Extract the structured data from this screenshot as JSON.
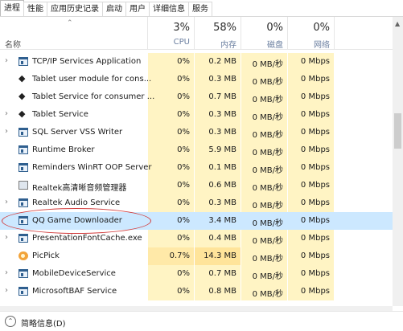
{
  "tabs": [
    "进程",
    "性能",
    "应用历史记录",
    "启动",
    "用户",
    "详细信息",
    "服务"
  ],
  "header": {
    "name_label": "名称",
    "sort_icon": "chevron-up-icon",
    "cpu": {
      "pct": "3%",
      "label": "CPU"
    },
    "memory": {
      "pct": "58%",
      "label": "内存"
    },
    "disk": {
      "pct": "0%",
      "label": "磁盘"
    },
    "network": {
      "pct": "0%",
      "label": "网络"
    }
  },
  "rows": [
    {
      "name": "TCP/IP Services Application",
      "expand": true,
      "icon": "app-window-icon",
      "cpu": "0%",
      "mem": "0.2 MB",
      "disk": "0 MB/秒",
      "net": "0 Mbps"
    },
    {
      "name": "Tablet user module for cons...",
      "expand": false,
      "icon": "service-icon",
      "cpu": "0%",
      "mem": "0.3 MB",
      "disk": "0 MB/秒",
      "net": "0 Mbps"
    },
    {
      "name": "Tablet Service for consumer ...",
      "expand": false,
      "icon": "service-icon",
      "cpu": "0%",
      "mem": "0.7 MB",
      "disk": "0 MB/秒",
      "net": "0 Mbps"
    },
    {
      "name": "Tablet Service",
      "expand": true,
      "icon": "service-icon",
      "cpu": "0%",
      "mem": "0.3 MB",
      "disk": "0 MB/秒",
      "net": "0 Mbps"
    },
    {
      "name": "SQL Server VSS Writer",
      "expand": true,
      "icon": "app-window-icon",
      "cpu": "0%",
      "mem": "0.3 MB",
      "disk": "0 MB/秒",
      "net": "0 Mbps"
    },
    {
      "name": "Runtime Broker",
      "expand": false,
      "icon": "app-window-icon",
      "cpu": "0%",
      "mem": "5.9 MB",
      "disk": "0 MB/秒",
      "net": "0 Mbps"
    },
    {
      "name": "Reminders WinRT OOP Server",
      "expand": false,
      "icon": "app-window-icon",
      "cpu": "0%",
      "mem": "0.1 MB",
      "disk": "0 MB/秒",
      "net": "0 Mbps"
    },
    {
      "name": "Realtek高清晰音频管理器",
      "expand": false,
      "icon": "speaker-icon",
      "cpu": "0%",
      "mem": "0.6 MB",
      "disk": "0 MB/秒",
      "net": "0 Mbps"
    },
    {
      "name": "Realtek Audio Service",
      "expand": true,
      "icon": "app-window-icon",
      "cpu": "0%",
      "mem": "0.3 MB",
      "disk": "0 MB/秒",
      "net": "0 Mbps"
    },
    {
      "name": "QQ Game Downloader",
      "expand": false,
      "icon": "app-window-icon",
      "cpu": "0%",
      "mem": "3.4 MB",
      "disk": "0 MB/秒",
      "net": "0 Mbps",
      "selected": true
    },
    {
      "name": "PresentationFontCache.exe",
      "expand": true,
      "icon": "app-window-icon",
      "cpu": "0%",
      "mem": "0.4 MB",
      "disk": "0 MB/秒",
      "net": "0 Mbps"
    },
    {
      "name": "PicPick",
      "expand": false,
      "icon": "picpick-icon",
      "cpu": "0.7%",
      "mem": "14.3 MB",
      "disk": "0 MB/秒",
      "net": "0 Mbps",
      "hot": true
    },
    {
      "name": "MobileDeviceService",
      "expand": true,
      "icon": "app-window-icon",
      "cpu": "0%",
      "mem": "0.7 MB",
      "disk": "0 MB/秒",
      "net": "0 Mbps"
    },
    {
      "name": "MicrosoftBAF Service",
      "expand": true,
      "icon": "app-window-icon",
      "cpu": "0%",
      "mem": "0.8 MB",
      "disk": "0 MB/秒",
      "net": "0 Mbps"
    }
  ],
  "footer": {
    "collapse_label": "简略信息(D)",
    "icon": "chevron-up-circle-icon"
  },
  "colors": {
    "heat_light": "#fff4c4",
    "heat_dark": "#ffe9a8",
    "selected": "#cce8ff",
    "annotation": "#d23c3c"
  }
}
